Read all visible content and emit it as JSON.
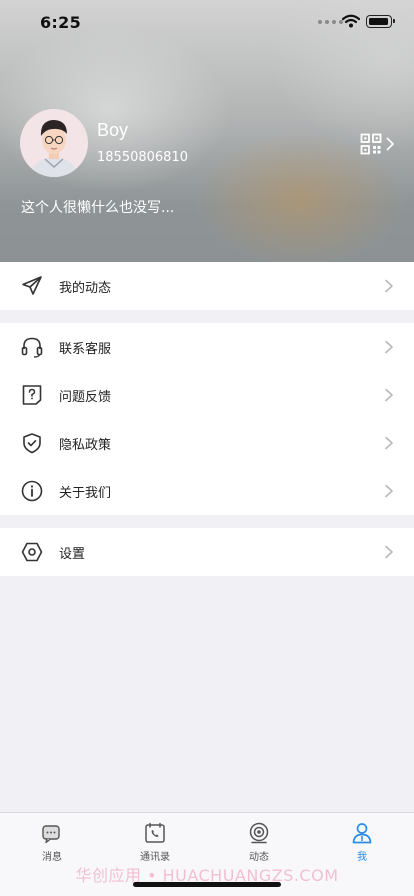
{
  "status": {
    "time": "6:25"
  },
  "profile": {
    "name": "Boy",
    "phone": "18550806810",
    "bio": "这个人很懒什么也没写..."
  },
  "menu": {
    "dynamics": "我的动态",
    "support": "联系客服",
    "feedback": "问题反馈",
    "privacy": "隐私政策",
    "about": "关于我们",
    "settings": "设置"
  },
  "tabs": [
    {
      "label": "消息",
      "icon": "message-icon",
      "active": false
    },
    {
      "label": "通讯录",
      "icon": "contacts-icon",
      "active": false
    },
    {
      "label": "动态",
      "icon": "camera-icon",
      "active": false
    },
    {
      "label": "我",
      "icon": "person-icon",
      "active": true
    }
  ],
  "watermark": "华创应用 • HUACHUANGZS.COM",
  "colors": {
    "accent": "#2a8ce4",
    "background": "#f1f1f5"
  }
}
